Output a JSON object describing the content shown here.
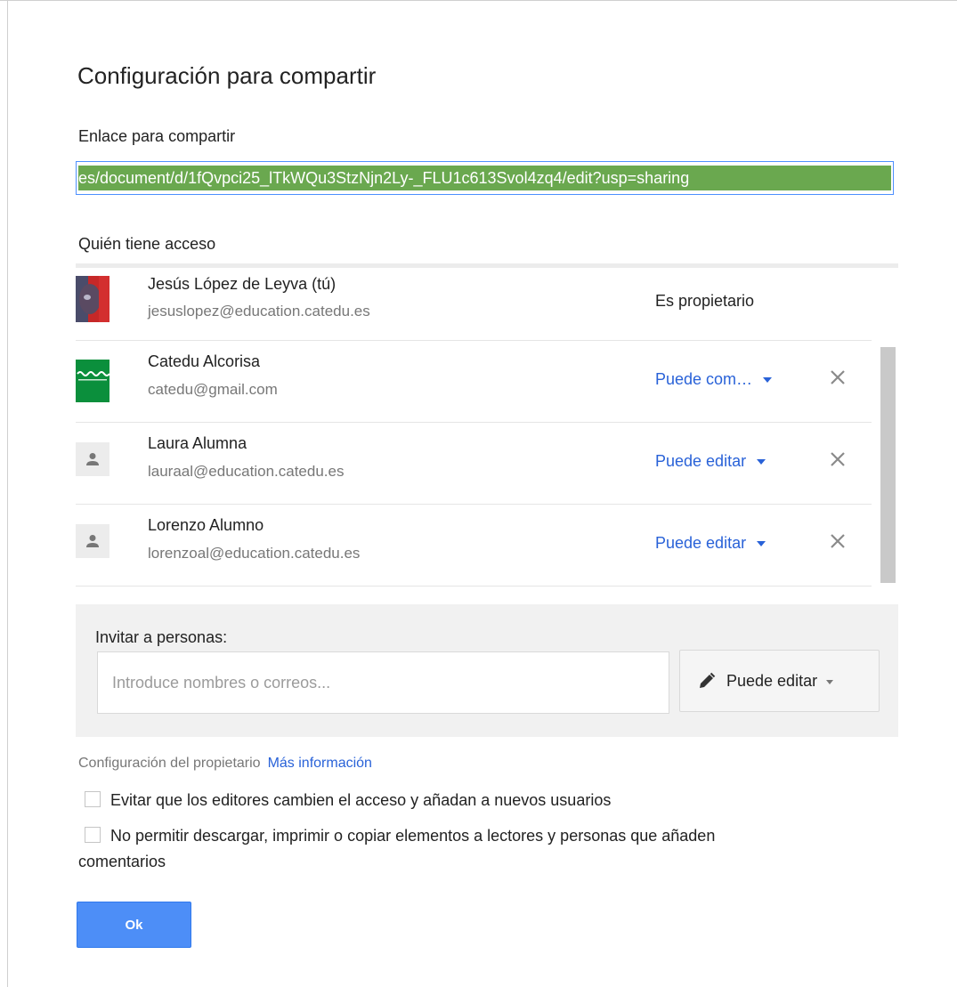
{
  "dialog": {
    "title": "Configuración para compartir",
    "link_section_label": "Enlace para compartir",
    "share_link_visible": "es/document/d/1fQvpci25_lTkWQu3StzNjn2Ly-_FLU1c613Svol4zq4/edit?usp=sharing",
    "access_section_label": "Quién tiene acceso"
  },
  "people": [
    {
      "name": "Jesús López de Leyva (tú)",
      "email": "jesuslopez@education.catedu.es",
      "role": "Es propietario"
    },
    {
      "name": "Catedu Alcorisa",
      "email": "catedu@gmail.com",
      "role": "Puede com…"
    },
    {
      "name": "Laura Alumna",
      "email": "lauraal@education.catedu.es",
      "role": "Puede editar"
    },
    {
      "name": "Lorenzo Alumno",
      "email": "lorenzoal@education.catedu.es",
      "role": "Puede editar"
    }
  ],
  "invite": {
    "label": "Invitar a personas:",
    "placeholder": "Introduce nombres o correos...",
    "permission": "Puede editar"
  },
  "owner_settings": {
    "label": "Configuración del propietario",
    "more_info": "Más información",
    "option1": "Evitar que los editores cambien el acceso y añadan a nuevos usuarios",
    "option2_line1": "No permitir descargar, imprimir o copiar elementos a lectores y personas que añaden",
    "option2_line2": "comentarios"
  },
  "ok_label": "Ok",
  "colors": {
    "link_selection": "#6aa84f",
    "link_blue": "#2962d8",
    "ok_button": "#4d8ef7"
  }
}
